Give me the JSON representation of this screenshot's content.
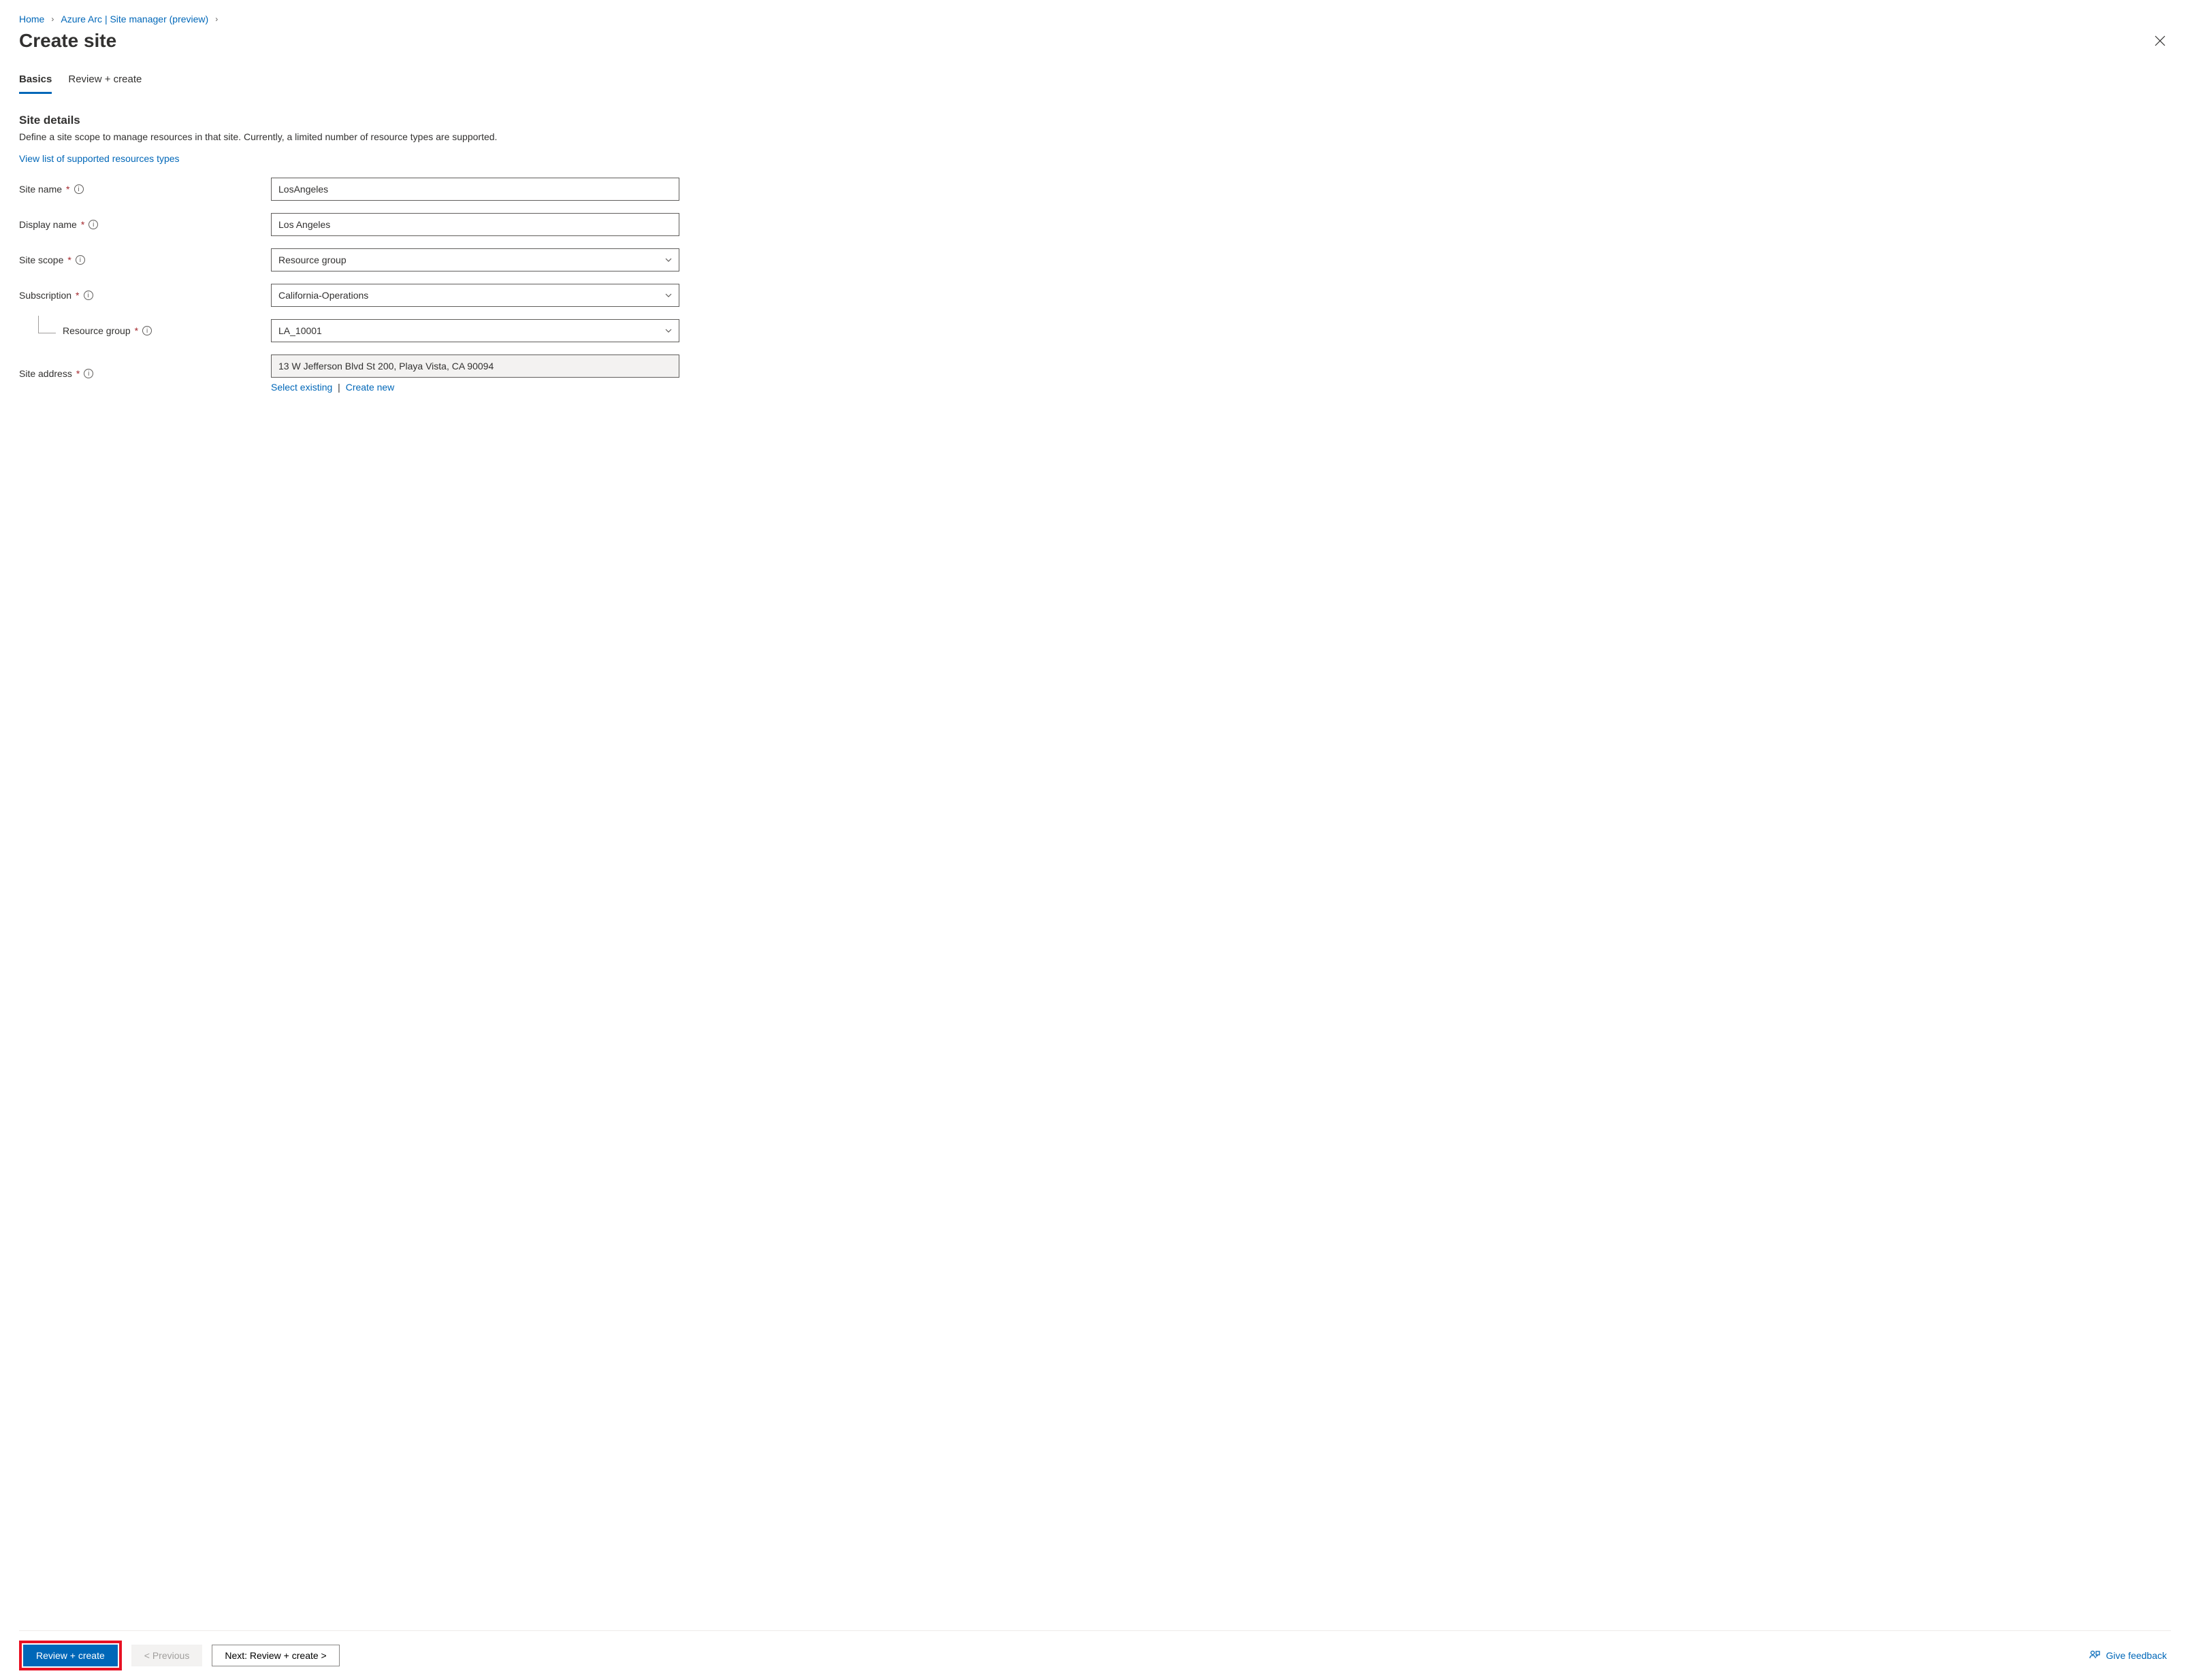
{
  "breadcrumb": {
    "home": "Home",
    "arc": "Azure Arc | Site manager (preview)"
  },
  "title": "Create site",
  "tabs": {
    "basics": "Basics",
    "review": "Review + create"
  },
  "section": {
    "heading": "Site details",
    "desc": "Define a site scope to manage resources in that site. Currently, a limited number of resource types are supported.",
    "link": "View list of supported resources types"
  },
  "fields": {
    "site_name": {
      "label": "Site name",
      "value": "LosAngeles"
    },
    "display_name": {
      "label": "Display name",
      "value": "Los Angeles"
    },
    "site_scope": {
      "label": "Site scope",
      "value": "Resource group"
    },
    "subscription": {
      "label": "Subscription",
      "value": "California-Operations"
    },
    "resource_group": {
      "label": "Resource group",
      "value": "LA_10001"
    },
    "site_address": {
      "label": "Site address",
      "value": "13 W Jefferson Blvd St 200, Playa Vista, CA 90094",
      "select_existing": "Select existing",
      "create_new": "Create new"
    }
  },
  "footer": {
    "review_create": "Review + create",
    "previous": "< Previous",
    "next": "Next: Review + create >",
    "feedback": "Give feedback"
  }
}
